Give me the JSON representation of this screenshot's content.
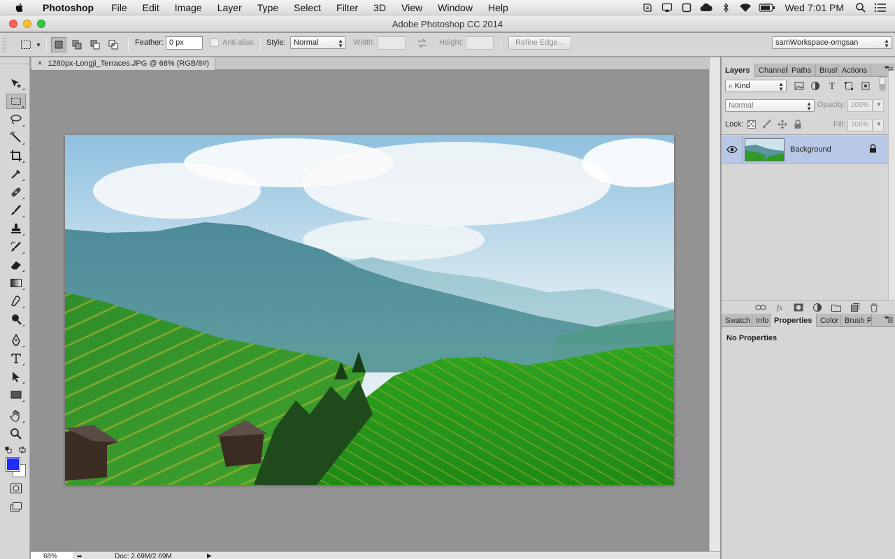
{
  "menubar": {
    "app_name": "Photoshop",
    "items": [
      "File",
      "Edit",
      "Image",
      "Layer",
      "Type",
      "Select",
      "Filter",
      "3D",
      "View",
      "Window",
      "Help"
    ],
    "clock": "Wed 7:01 PM",
    "status_icons": [
      "apple-icon",
      "script-icon",
      "airplay-icon",
      "window-icon",
      "cloud-icon",
      "bluetooth-icon",
      "wifi-icon",
      "battery-icon",
      "spotlight-icon",
      "notification-list-icon"
    ]
  },
  "window": {
    "title": "Adobe Photoshop CC 2014"
  },
  "options_bar": {
    "feather_label": "Feather:",
    "feather_value": "0 px",
    "anti_alias_label": "Anti-alias",
    "style_label": "Style:",
    "style_value": "Normal",
    "width_label": "Width:",
    "height_label": "Height:",
    "refine_edge_label": "Refine Edge...",
    "workspace_value": "samWorkspace-omgsan"
  },
  "document": {
    "tab_close": "×",
    "tab_title": "1280px-Longji_Terraces.JPG @ 68% (RGB/8#)",
    "image_subject": "Longji rice terraces with mountains and sky"
  },
  "status_bar": {
    "zoom": "68%",
    "doc_info": "Doc: 2.69M/2.69M"
  },
  "layers_panel": {
    "tabs": [
      "Layers",
      "Channel",
      "Paths",
      "Brush",
      "Actions"
    ],
    "active_tab": "Layers",
    "kind_filter": "Kind",
    "blend_mode": "Normal",
    "opacity_label": "Opacity:",
    "opacity_value": "100%",
    "lock_label": "Lock:",
    "fill_label": "Fill:",
    "fill_value": "100%",
    "layers": [
      {
        "name": "Background",
        "visible": true,
        "locked": true,
        "selected": true
      }
    ]
  },
  "properties_panel": {
    "tabs": [
      "Swatch",
      "Info",
      "Properties",
      "Color",
      "Brush P"
    ],
    "active_tab": "Properties",
    "body_text": "No Properties"
  },
  "colors": {
    "foreground": "#1f2cf5",
    "background": "#ffffff",
    "selected_layer": "#b6c8e6"
  }
}
